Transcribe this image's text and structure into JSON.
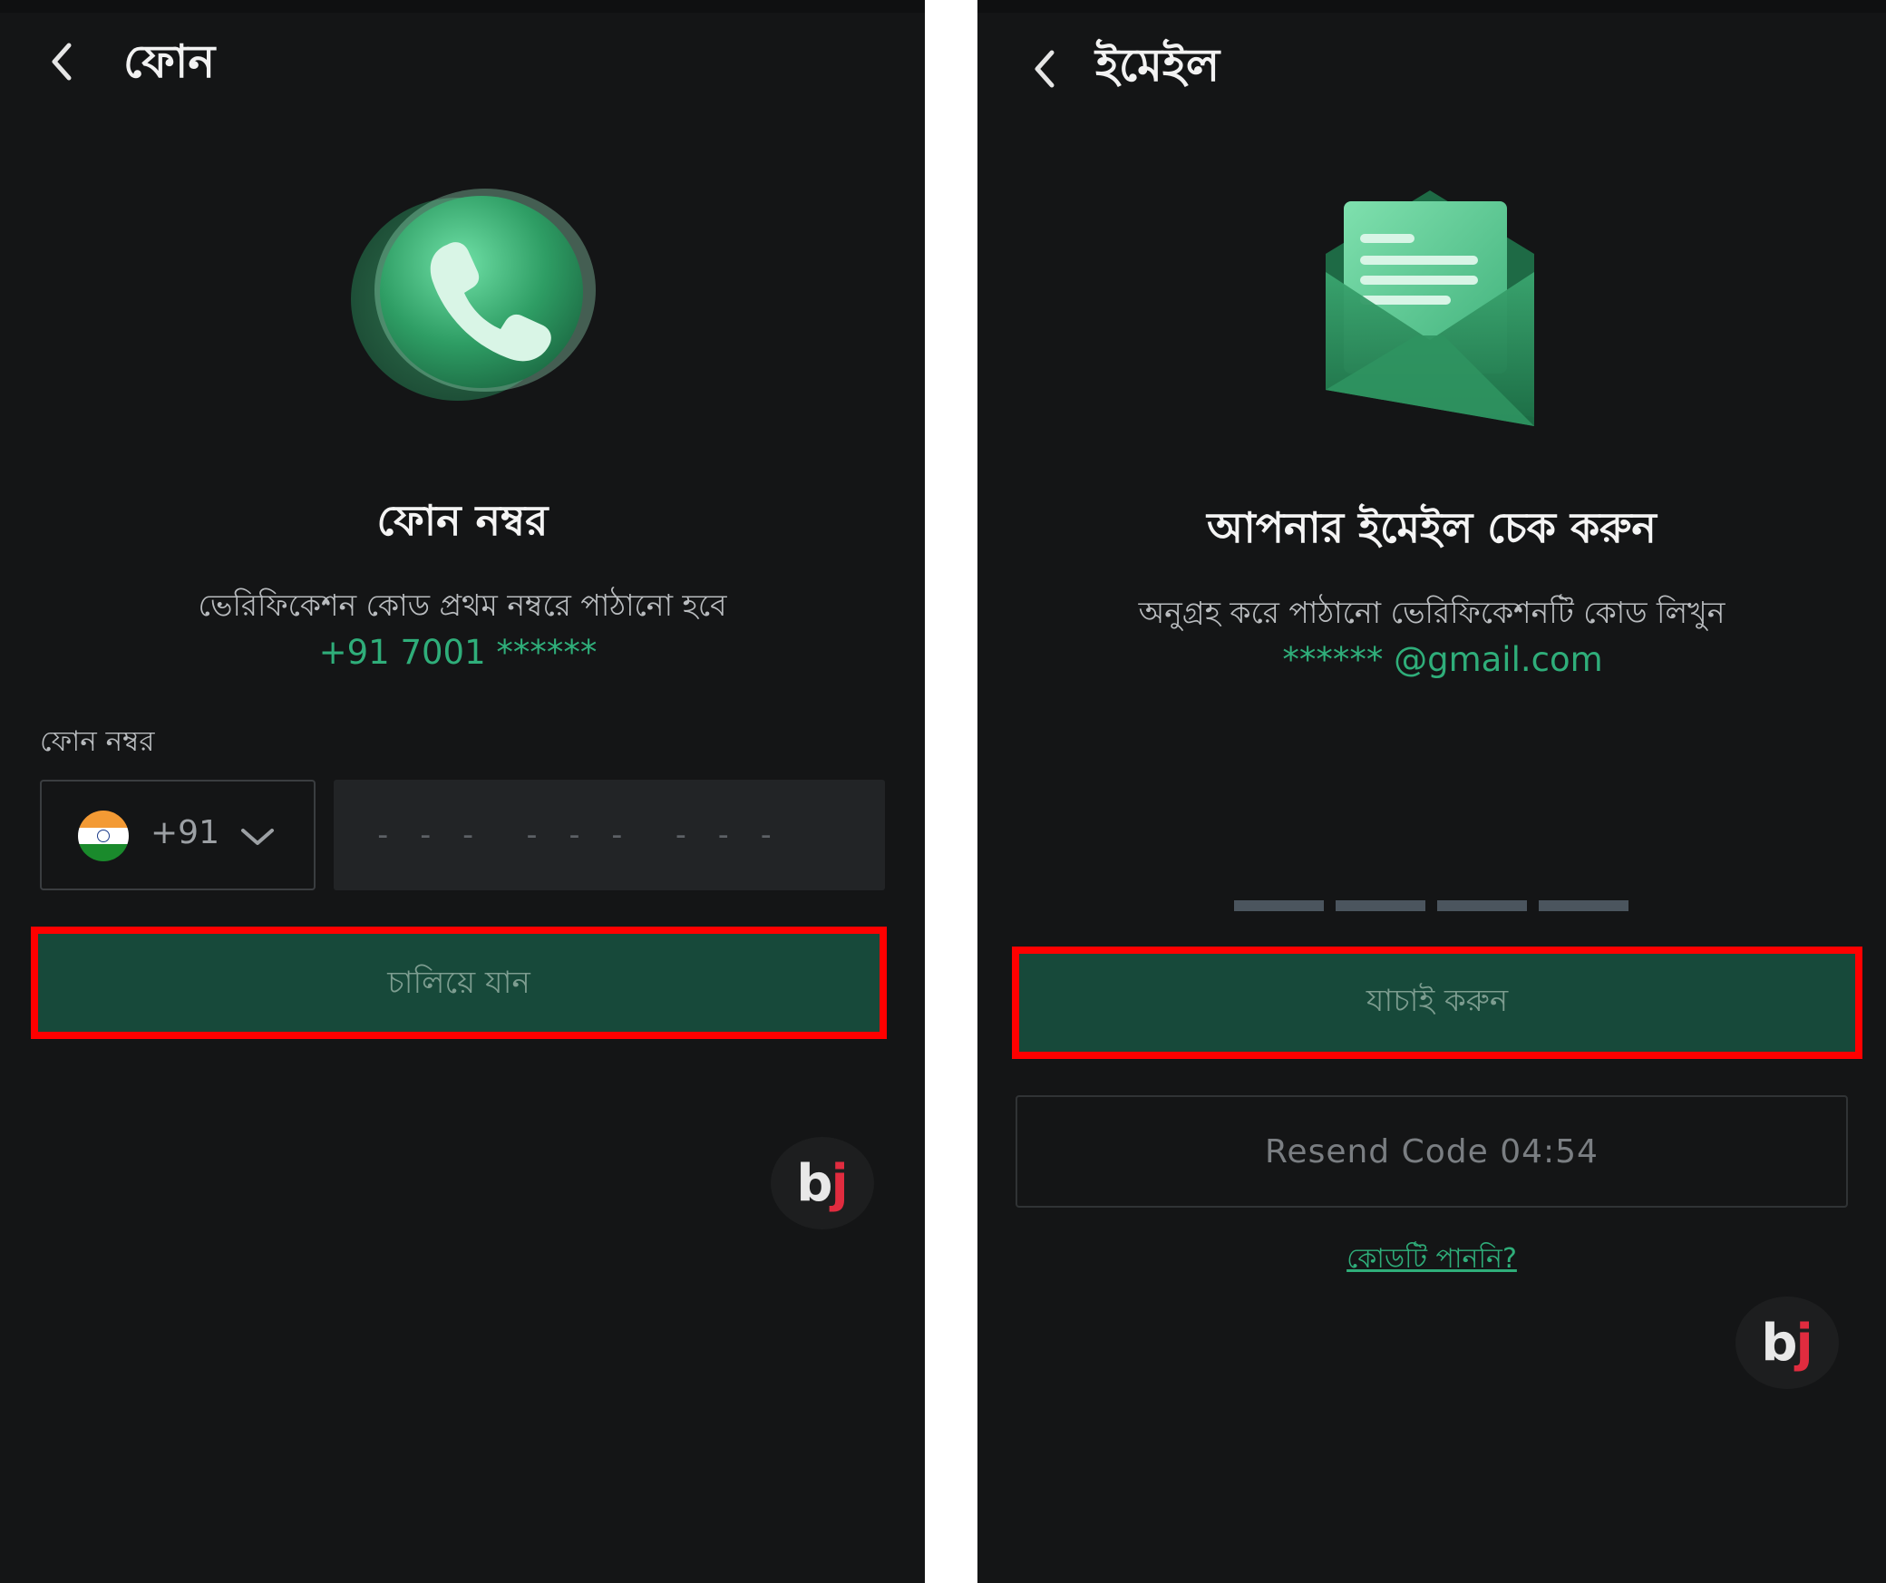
{
  "phone_screen": {
    "header": {
      "title": "ফোন"
    },
    "hero_icon": "phone-icon",
    "heading": "ফোন নম্বর",
    "description": "ভেরিফিকেশন কোড প্রথম নম্বরে পাঠানো হবে",
    "masked_number": "+91 7001 ******",
    "field_label": "ফোন নম্বর",
    "country_code": {
      "flag": "india-flag-icon",
      "code": "+91"
    },
    "phone_input": {
      "placeholder": "- - -  - - -  - - -",
      "value": ""
    },
    "continue_button": "চালিয়ে যান",
    "logo": {
      "b": "b",
      "j": "j"
    }
  },
  "email_screen": {
    "header": {
      "title": "ইমেইল"
    },
    "hero_icon": "envelope-icon",
    "heading": "আপনার ইমেইল চেক করুন",
    "description": "অনুগ্রহ করে পাঠানো ভেরিফিকেশনটি কোড লিখুন",
    "masked_email": "****** @gmail.com",
    "otp_slots": 4,
    "verify_button": "যাচাই করুন",
    "resend_button": "Resend Code 04:54",
    "no_code_link": "কোডটি পাননি?",
    "logo": {
      "b": "b",
      "j": "j"
    }
  },
  "colors": {
    "background": "#141516",
    "accent": "#2fae7a",
    "primary_button": "#17493a",
    "highlight": "#ff0000"
  }
}
